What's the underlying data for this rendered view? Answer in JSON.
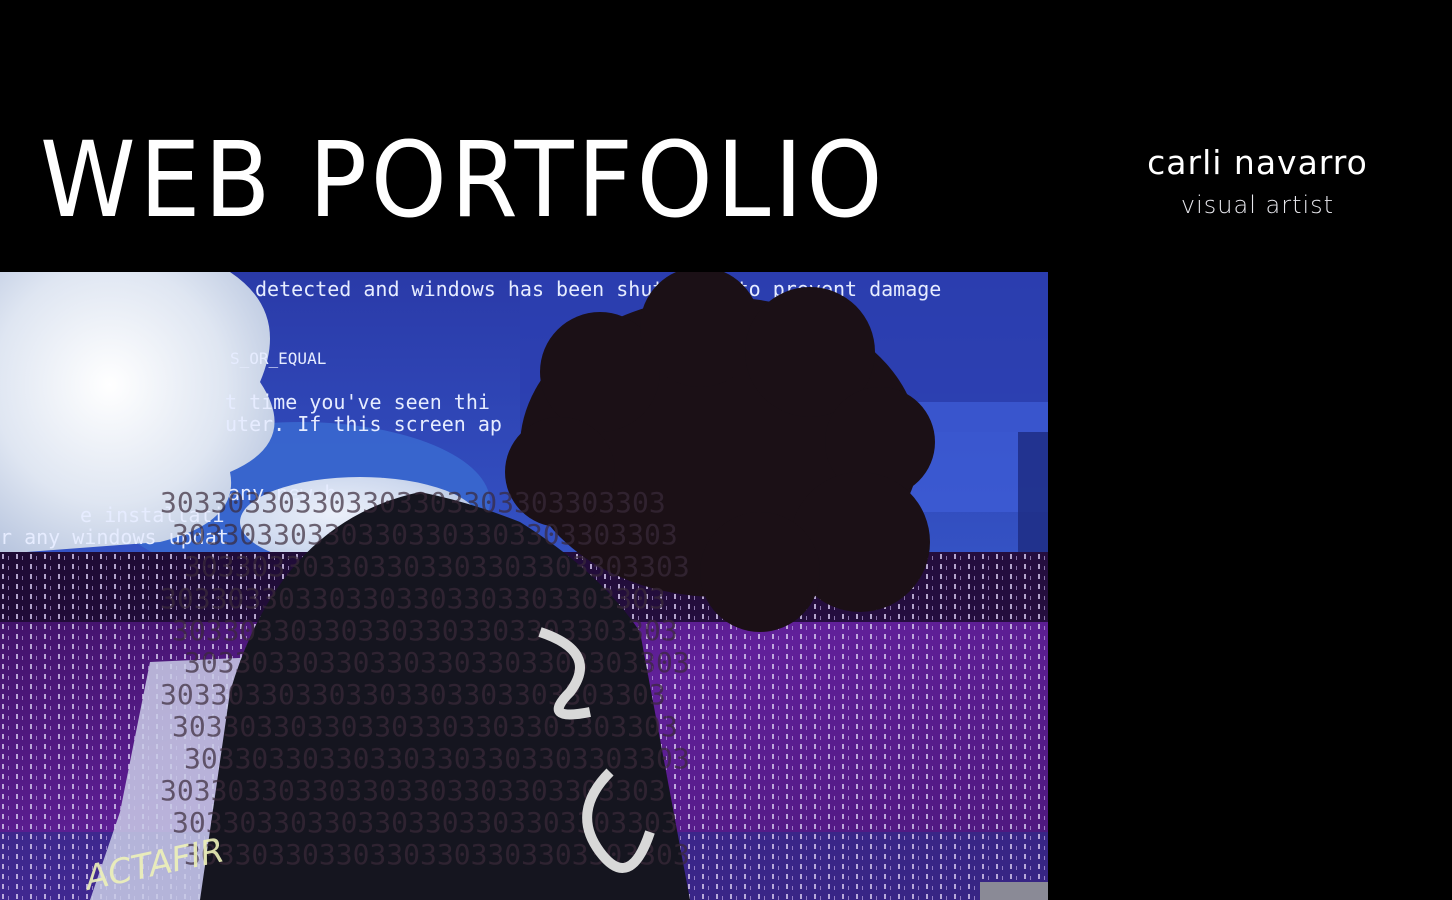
{
  "header": {
    "title": "WEB PORTFOLIO"
  },
  "artist": {
    "name": "carli navarro",
    "role": "visual artist"
  },
  "hero": {
    "image_icon": "glitch-portrait-image",
    "bsod_lines": [
      "detected and windows has been shut down to prevent damage",
      "S_OR_EQUAL",
      "t time you've seen thi",
      "uter. If this screen ap",
      "any new h",
      "e installati",
      "r any windows updat"
    ],
    "glitch_digits": "303303303303303303303303303303",
    "shirt_text": "ACTAFIR",
    "colors": {
      "bsod_blue": "#2f3fb0",
      "glitch_purple": "#5a1a86",
      "sky": "#3b6fd0",
      "cloud": "#e9eef7"
    }
  }
}
